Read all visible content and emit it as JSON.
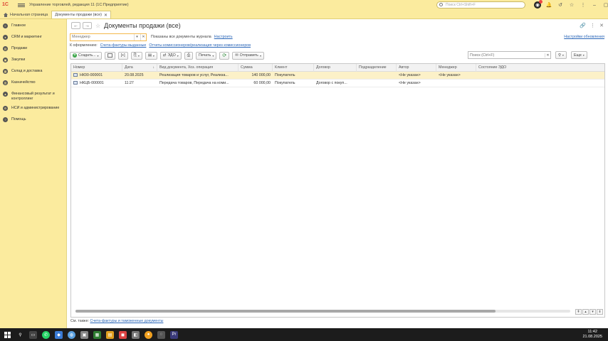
{
  "titlebar": {
    "app_title": "Управление торговлей, редакция 11  (1С:Предприятие)",
    "search_placeholder": "Поиск Ctrl+Shift+F"
  },
  "tabs": [
    {
      "label": "Начальная страница"
    },
    {
      "label": "Документы продажи (все)"
    }
  ],
  "sidebar": {
    "items": [
      {
        "label": "Главное",
        "icon": "home-icon"
      },
      {
        "label": "CRM и маркетинг",
        "icon": "crm-icon"
      },
      {
        "label": "Продажи",
        "icon": "sales-icon"
      },
      {
        "label": "Закупки",
        "icon": "purchases-icon"
      },
      {
        "label": "Склад и доставка",
        "icon": "warehouse-icon"
      },
      {
        "label": "Казначейство",
        "icon": "treasury-icon"
      },
      {
        "label": "Финансовый результат и контроллинг",
        "icon": "finance-icon"
      },
      {
        "label": "НСИ и администрирование",
        "icon": "settings-icon"
      },
      {
        "label": "Помощь",
        "icon": "help-icon"
      }
    ]
  },
  "page": {
    "title": "Документы продажи (все)",
    "manager_placeholder": "Менеджер",
    "shown_text": "Показаны все документы журнала",
    "setup_link": "Настроить",
    "update_link": "Настройки обновления",
    "todo_label": "К оформлению:",
    "todo_link1": "Счета-фактуры выданные",
    "todo_link2": "Отчеты комиссионеров/реализация через комиссионеров"
  },
  "toolbar": {
    "create_label": "Создать...",
    "edo_label": "ЭДО",
    "print_label": "Печать",
    "send_label": "Отправить",
    "search_placeholder": "Поиск (Ctrl+F)",
    "more_label": "Еще"
  },
  "table": {
    "columns": [
      "Номер",
      "Дата",
      "Вид документа, Хоз. операция",
      "Сумма",
      "Клиент",
      "Договор",
      "Подразделение",
      "Автор",
      "Менеджер",
      "Состояние ЭДО"
    ],
    "rows": [
      {
        "number": "НК00-000001",
        "date": "20.08.2025",
        "type": "Реализация товаров и услуг, Реализа...",
        "sum": "140 000,00",
        "client": "Покупатель",
        "contract": "",
        "division": "",
        "author": "<Не указан>",
        "manager": "<Не указан>",
        "edo": ""
      },
      {
        "number": "НКЦБ-000001",
        "date": "11:27",
        "type": "Передача товаров, Передача на коми...",
        "sum": "60 000,00",
        "client": "Покупатель",
        "contract": "Договор с покуп...",
        "division": "",
        "author": "<Не указан>",
        "manager": "",
        "edo": ""
      }
    ]
  },
  "footer": {
    "see_also": "См. также:",
    "see_also_link": "Счета-фактуры и таможенные документы"
  },
  "taskbar": {
    "time": "11:42",
    "date": "21.08.2025"
  },
  "colors": {
    "chrome": "#fbeb9e",
    "selected_row": "#fcf1c8",
    "link": "#2a66b8"
  }
}
